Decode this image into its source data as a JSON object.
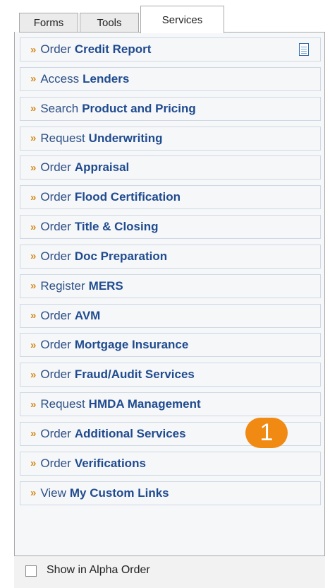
{
  "tabs": [
    {
      "label": "Forms",
      "active": false
    },
    {
      "label": "Tools",
      "active": false
    },
    {
      "label": "Services",
      "active": true
    }
  ],
  "services": [
    {
      "verb": "Order",
      "object": "Credit Report",
      "icon": "document-icon"
    },
    {
      "verb": "Access",
      "object": "Lenders"
    },
    {
      "verb": "Search",
      "object": "Product and Pricing"
    },
    {
      "verb": "Request",
      "object": "Underwriting"
    },
    {
      "verb": "Order",
      "object": "Appraisal"
    },
    {
      "verb": "Order",
      "object": "Flood Certification"
    },
    {
      "verb": "Order",
      "object": "Title & Closing"
    },
    {
      "verb": "Order",
      "object": "Doc Preparation"
    },
    {
      "verb": "Register",
      "object": "MERS"
    },
    {
      "verb": "Order",
      "object": "AVM"
    },
    {
      "verb": "Order",
      "object": "Mortgage Insurance"
    },
    {
      "verb": "Order",
      "object": "Fraud/Audit Services"
    },
    {
      "verb": "Request",
      "object": "HMDA Management"
    },
    {
      "verb": "Order",
      "object": "Additional Services"
    },
    {
      "verb": "Order",
      "object": "Verifications"
    },
    {
      "verb": "View",
      "object": "My Custom Links"
    }
  ],
  "arrow_glyph": "»",
  "badge": {
    "text": "1",
    "color": "#f08a12"
  },
  "footer": {
    "checkbox_label": "Show in Alpha Order",
    "checked": false
  }
}
